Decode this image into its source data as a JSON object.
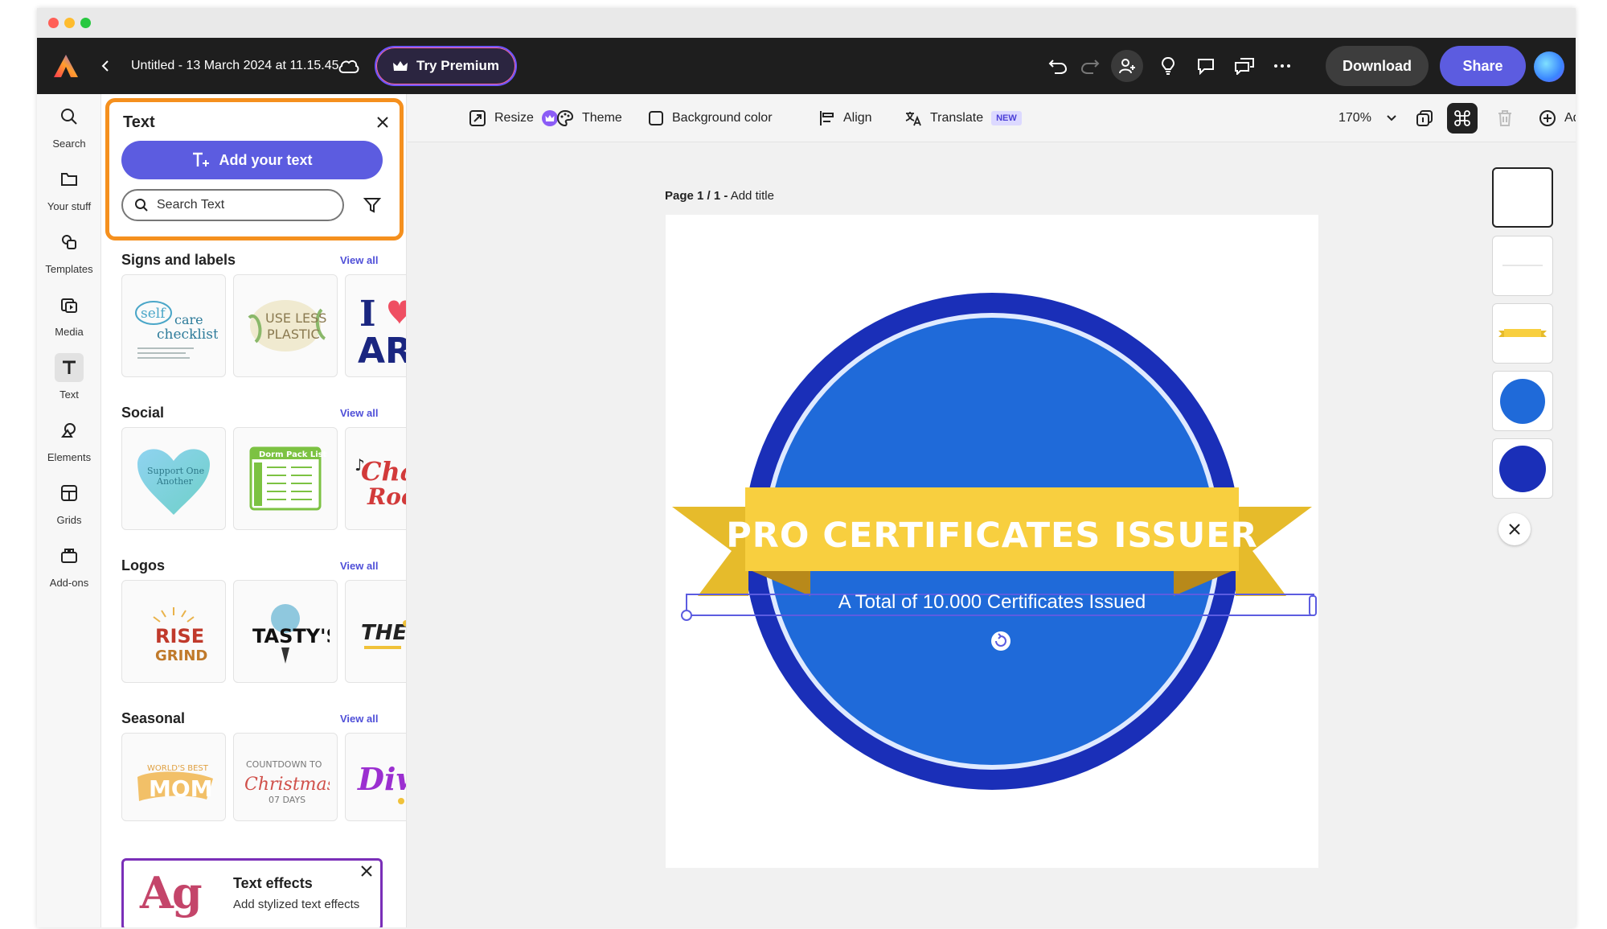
{
  "window": {
    "doc_title": "Untitled - 13 March 2024 at 11.15.45",
    "try_premium": "Try Premium",
    "download": "Download",
    "share": "Share"
  },
  "rail": [
    {
      "label": "Search",
      "icon": "search-icon"
    },
    {
      "label": "Your stuff",
      "icon": "folder-icon"
    },
    {
      "label": "Templates",
      "icon": "templates-icon"
    },
    {
      "label": "Media",
      "icon": "media-icon"
    },
    {
      "label": "Text",
      "icon": "text-icon",
      "active": true
    },
    {
      "label": "Elements",
      "icon": "elements-icon"
    },
    {
      "label": "Grids",
      "icon": "grids-icon"
    },
    {
      "label": "Add-ons",
      "icon": "addons-icon"
    }
  ],
  "panel": {
    "title": "Text",
    "add_text": "Add your text",
    "search_placeholder": "Search Text",
    "view_all": "View all",
    "sections": [
      {
        "title": "Signs and labels",
        "cards": [
          "self care checklist",
          "USE LESS PLASTIC",
          "I AR"
        ]
      },
      {
        "title": "Social",
        "cards": [
          "Support One Another",
          "Dorm Pack List",
          "Cha Rock"
        ]
      },
      {
        "title": "Logos",
        "cards": [
          "RISE GRIND",
          "TASTY'S",
          "THE"
        ]
      },
      {
        "title": "Seasonal",
        "cards": [
          "WORLD'S BEST MOM",
          "COUNTDOWN TO Christmas 07 DAYS",
          "Diw"
        ]
      }
    ],
    "text_effects": {
      "title": "Text effects",
      "subtitle": "Add stylized text effects",
      "sample": "Ag"
    }
  },
  "propbar": {
    "resize": "Resize",
    "theme": "Theme",
    "background_color": "Background color",
    "align": "Align",
    "translate": "Translate",
    "new_badge": "NEW",
    "zoom": "170%",
    "add": "Add"
  },
  "page": {
    "label_bold": "Page 1 / 1 -",
    "label_rest": " Add title"
  },
  "design": {
    "title": "PRO CERTIFICATES ISSUER",
    "subtitle": "A Total of 10.000 Certificates Issued",
    "colors": {
      "outer_ring": "#1a2fb8",
      "inner_fill": "#1f6ad9",
      "ribbon": "#f8cf3f",
      "ribbon_dark": "#e2b423",
      "selection": "#5c5ce0"
    }
  },
  "accent": {
    "highlight": "#f5901e",
    "primary": "#5c5ce0"
  }
}
